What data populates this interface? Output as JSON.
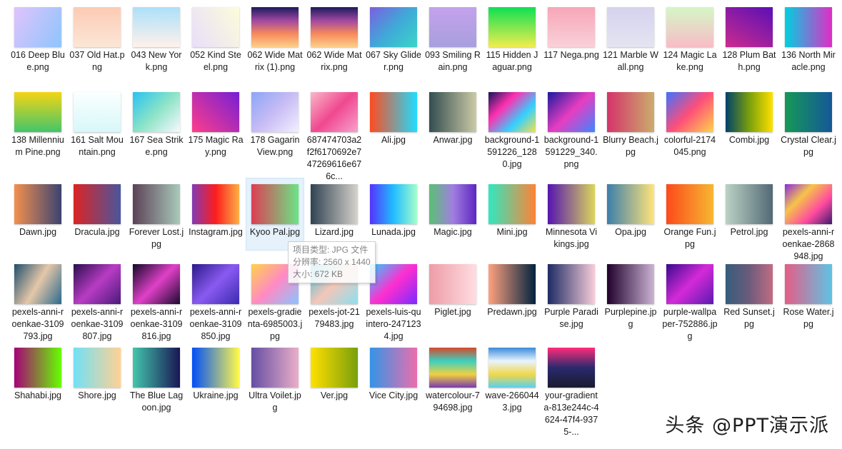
{
  "files": [
    {
      "label": "016 Deep Blue.png",
      "colors": [
        "#e0c3fc",
        "#8ec5fc"
      ],
      "angle": 120
    },
    {
      "label": "037 Old Hat.png",
      "colors": [
        "#fdcbb4",
        "#fbe6d6"
      ],
      "angle": 180
    },
    {
      "label": "043 New York.png",
      "colors": [
        "#fff1eb",
        "#ace0f9"
      ],
      "angle": 0
    },
    {
      "label": "052 Kind Steel.png",
      "colors": [
        "#e9defa",
        "#fbfcdb"
      ],
      "angle": 60
    },
    {
      "label": "062 Wide Matrix (1).png",
      "colors": [
        "#1c1a5e",
        "#a048a0",
        "#f78a5c",
        "#fdd08a"
      ],
      "angle": 180
    },
    {
      "label": "062 Wide Matrix.png",
      "colors": [
        "#1c1a5e",
        "#a048a0",
        "#f78a5c",
        "#fdd08a"
      ],
      "angle": 180
    },
    {
      "label": "067 Sky Glider.png",
      "colors": [
        "#7b5fe0",
        "#40a8d8",
        "#3ad6c8"
      ],
      "angle": 135
    },
    {
      "label": "093 Smiling Rain.png",
      "colors": [
        "#c4a2ec",
        "#a89fdd"
      ],
      "angle": 180
    },
    {
      "label": "115 Hidden Jaguar.png",
      "colors": [
        "#0ee052",
        "#f2ed4e"
      ],
      "angle": 180
    },
    {
      "label": "117 Nega.png",
      "colors": [
        "#f7a6b8",
        "#f9d1d9"
      ],
      "angle": 180
    },
    {
      "label": "121 Marble Wall.png",
      "colors": [
        "#d6d2ef",
        "#e4e4f1"
      ],
      "angle": 180
    },
    {
      "label": "124 Magic Lake.png",
      "colors": [
        "#d5f7c6",
        "#f8bcc6"
      ],
      "angle": 180
    },
    {
      "label": "128 Plum Bath.png",
      "colors": [
        "#cc2b8e",
        "#5a10b6"
      ],
      "angle": 30
    },
    {
      "label": "136 North Miracle.png",
      "colors": [
        "#00d0e0",
        "#e12cc6"
      ],
      "angle": 90
    },
    {
      "label": "138 Millennium Pine.png",
      "colors": [
        "#f4d415",
        "#42c66b"
      ],
      "angle": 180
    },
    {
      "label": "161 Salt Mountain.png",
      "colors": [
        "#fbffff",
        "#d7f7f9"
      ],
      "angle": 180
    },
    {
      "label": "167 Sea Strike.png",
      "colors": [
        "#28c2f3",
        "#8ae3c6",
        "#f9f8ff"
      ],
      "angle": 135
    },
    {
      "label": "175 Magic Ray.png",
      "colors": [
        "#ff3d8b",
        "#7520d4"
      ],
      "angle": 45
    },
    {
      "label": "178 Gagarin View.png",
      "colors": [
        "#8ba5f6",
        "#c8bcf5",
        "#f3efff"
      ],
      "angle": 135
    },
    {
      "label": "687474703a2f2f6170692e747269616e676c...",
      "colors": [
        "#f9b8c8",
        "#f04890",
        "#f7a2cc"
      ],
      "angle": 135
    },
    {
      "label": "Ali.jpg",
      "colors": [
        "#ff4b1f",
        "#1fddff"
      ],
      "angle": 90
    },
    {
      "label": "Anwar.jpg",
      "colors": [
        "#334d50",
        "#cbcaa5"
      ],
      "angle": 90
    },
    {
      "label": "background-1591226_1280.jpg",
      "colors": [
        "#15145a",
        "#ff2fb0",
        "#34d0ff",
        "#f4e04c"
      ],
      "angle": 135
    },
    {
      "label": "background-1591229_340.png",
      "colors": [
        "#1b1a9e",
        "#e73dc1",
        "#3d86ff"
      ],
      "angle": 135
    },
    {
      "label": "Blurry Beach.jpg",
      "colors": [
        "#d53369",
        "#cbad6d"
      ],
      "angle": 90
    },
    {
      "label": "colorful-2174045.png",
      "colors": [
        "#3e72ff",
        "#ff4e7a",
        "#ffd44a"
      ],
      "angle": 135
    },
    {
      "label": "Combi.jpg",
      "colors": [
        "#00416a",
        "#799f0c",
        "#ffe000"
      ],
      "angle": 90
    },
    {
      "label": "Crystal Clear.jpg",
      "colors": [
        "#159957",
        "#155799"
      ],
      "angle": 90
    },
    {
      "label": "Dawn.jpg",
      "colors": [
        "#f3904f",
        "#3b4371"
      ],
      "angle": 90
    },
    {
      "label": "Dracula.jpg",
      "colors": [
        "#dc2424",
        "#4a569d"
      ],
      "angle": 90
    },
    {
      "label": "Forever Lost.jpg",
      "colors": [
        "#5d4157",
        "#a8caba"
      ],
      "angle": 90
    },
    {
      "label": "Instagram.jpg",
      "colors": [
        "#833ab4",
        "#fd1d1d",
        "#fcb045"
      ],
      "angle": 90
    },
    {
      "label": "Kyoo Pal.jpg",
      "colors": [
        "#dd3e54",
        "#6be585"
      ],
      "angle": 90
    },
    {
      "label": "Lizard.jpg",
      "colors": [
        "#304352",
        "#d7d2cc"
      ],
      "angle": 90
    },
    {
      "label": "Lunada.jpg",
      "colors": [
        "#5433ff",
        "#20bdff",
        "#a5fecb"
      ],
      "angle": 90
    },
    {
      "label": "Magic.jpg",
      "colors": [
        "#59c173",
        "#a17fe0",
        "#5d26c1"
      ],
      "angle": 90
    },
    {
      "label": "Mini.jpg",
      "colors": [
        "#30e8bf",
        "#ff8235"
      ],
      "angle": 90
    },
    {
      "label": "Minnesota Vikings.jpg",
      "colors": [
        "#5614b0",
        "#dbd65c"
      ],
      "angle": 90
    },
    {
      "label": "Opa.jpg",
      "colors": [
        "#3d7eaa",
        "#ffe47a"
      ],
      "angle": 90
    },
    {
      "label": "Orange Fun.jpg",
      "colors": [
        "#fc4a1a",
        "#f7b733"
      ],
      "angle": 90
    },
    {
      "label": "Petrol.jpg",
      "colors": [
        "#bbd2c5",
        "#536976"
      ],
      "angle": 90
    },
    {
      "label": "pexels-anni-roenkae-2868948.jpg",
      "colors": [
        "#8a2be2",
        "#f6c34a",
        "#ff4aa0",
        "#3a1a6e"
      ],
      "angle": 135
    },
    {
      "label": "pexels-anni-roenkae-3109793.jpg",
      "colors": [
        "#1f4f6e",
        "#e5c7a8",
        "#2a6a8e"
      ],
      "angle": 120
    },
    {
      "label": "pexels-anni-roenkae-3109807.jpg",
      "colors": [
        "#2a0f4e",
        "#b83cc4",
        "#4a1a7a"
      ],
      "angle": 135
    },
    {
      "label": "pexels-anni-roenkae-3109816.jpg",
      "colors": [
        "#140828",
        "#e040c8",
        "#1a0a2e"
      ],
      "angle": 135
    },
    {
      "label": "pexels-anni-roenkae-3109850.jpg",
      "colors": [
        "#2a1a8a",
        "#8a5af0",
        "#3a2ab0"
      ],
      "angle": 135
    },
    {
      "label": "pexels-gradienta-6985003.jpg",
      "colors": [
        "#ffd14a",
        "#ff8ac4",
        "#8ac4ff"
      ],
      "angle": 135
    },
    {
      "label": "pexels-jot-2179483.jpg",
      "colors": [
        "#3ac0d8",
        "#f4c6b8",
        "#8ae0f0"
      ],
      "angle": 135
    },
    {
      "label": "pexels-luis-quintero-2471234.jpg",
      "colors": [
        "#2bd0ff",
        "#ff2ecf",
        "#7a2bff"
      ],
      "angle": 135
    },
    {
      "label": "Piglet.jpg",
      "colors": [
        "#ee9ca7",
        "#ffdde1"
      ],
      "angle": 90
    },
    {
      "label": "Predawn.jpg",
      "colors": [
        "#ffa17f",
        "#00223e"
      ],
      "angle": 90
    },
    {
      "label": "Purple Paradise.jpg",
      "colors": [
        "#1d2b64",
        "#f8cdda"
      ],
      "angle": 90
    },
    {
      "label": "Purplepine.jpg",
      "colors": [
        "#20002c",
        "#cbb4d4"
      ],
      "angle": 90
    },
    {
      "label": "purple-wallpaper-752886.jpg",
      "colors": [
        "#3a0a8e",
        "#d42ad8",
        "#5a1ab0"
      ],
      "angle": 135
    },
    {
      "label": "Red Sunset.jpg",
      "colors": [
        "#355c7d",
        "#6c5b7b",
        "#c06c84"
      ],
      "angle": 90
    },
    {
      "label": "Rose Water.jpg",
      "colors": [
        "#e55d87",
        "#5fc3e4"
      ],
      "angle": 90
    },
    {
      "label": "Shahabi.jpg",
      "colors": [
        "#a80077",
        "#66ff00"
      ],
      "angle": 90
    },
    {
      "label": "Shore.jpg",
      "colors": [
        "#70e1f5",
        "#ffd194"
      ],
      "angle": 90
    },
    {
      "label": "The Blue Lagoon.jpg",
      "colors": [
        "#43c6ac",
        "#191654"
      ],
      "angle": 90
    },
    {
      "label": "Ukraine.jpg",
      "colors": [
        "#004ff9",
        "#fff94c"
      ],
      "angle": 90
    },
    {
      "label": "Ultra Voilet.jpg",
      "colors": [
        "#654ea3",
        "#eaafc8"
      ],
      "angle": 90
    },
    {
      "label": "Ver.jpg",
      "colors": [
        "#ffe000",
        "#799f0c"
      ],
      "angle": 90
    },
    {
      "label": "Vice City.jpg",
      "colors": [
        "#3494e6",
        "#ec6ead"
      ],
      "angle": 90
    },
    {
      "label": "watercolour-794698.jpg",
      "colors": [
        "#d44a2a",
        "#3ad0c0",
        "#f0d040",
        "#7a3ab0"
      ],
      "angle": 180
    },
    {
      "label": "wave-2660443.jpg",
      "colors": [
        "#3a8ad8",
        "#e8f4ff",
        "#f0d84a",
        "#5ad0f0"
      ],
      "angle": 180
    },
    {
      "label": "your-gradienta-813e244c-4624-47f4-9375-...",
      "colors": [
        "#ff2c7a",
        "#2a2a6e",
        "#1a1a2e"
      ],
      "angle": 180
    }
  ],
  "selected_label": "Kyoo Pal.jpg",
  "tooltip": {
    "type_line": "项目类型: JPG 文件",
    "resolution_line": "分辨率: 2560 x 1440",
    "size_line": "大小: 672 KB"
  },
  "watermark": "头条 @PPT演示派"
}
